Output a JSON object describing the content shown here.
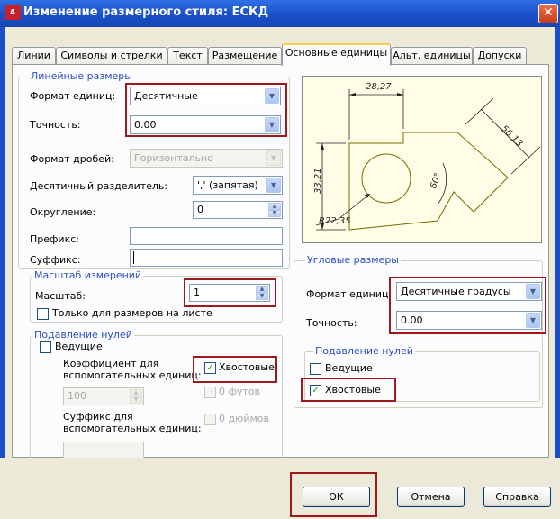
{
  "window": {
    "title": "Изменение размерного стиля: ЕСКД",
    "app_icon": "autocad-icon",
    "close_label": "✕"
  },
  "tabs": [
    {
      "label": "Линии"
    },
    {
      "label": "Символы и стрелки"
    },
    {
      "label": "Текст"
    },
    {
      "label": "Размещение"
    },
    {
      "label": "Основные единицы",
      "active": true
    },
    {
      "label": "Альт. единицы"
    },
    {
      "label": "Допуски"
    }
  ],
  "linear": {
    "legend": "Линейные размеры",
    "unit_format_label": "Формат единиц:",
    "unit_format_value": "Десятичные",
    "precision_label": "Точность:",
    "precision_value": "0.00",
    "fraction_format_label": "Формат дробей:",
    "fraction_format_value": "Горизонтально",
    "decimal_sep_label": "Десятичный разделитель:",
    "decimal_sep_value": "',' (запятая)",
    "rounding_label": "Округление:",
    "rounding_value": "0",
    "prefix_label": "Префикс:",
    "prefix_value": "",
    "suffix_label": "Суффикс:",
    "suffix_value": ""
  },
  "scale": {
    "legend": "Масштаб измерений",
    "scale_label": "Масштаб:",
    "scale_value": "1",
    "layout_only_label": "Только для размеров на листе",
    "layout_only_checked": false
  },
  "zero_linear": {
    "legend": "Подавление нулей",
    "leading_label": "Ведущие",
    "leading_checked": false,
    "sub_factor_label_1": "Коэффициент для",
    "sub_factor_label_2": "вспомогательных единиц:",
    "sub_factor_value": "100",
    "trailing_label": "Хвостовые",
    "trailing_checked": true,
    "feet_label": "0 футов",
    "sub_suffix_label_1": "Суффикс для",
    "sub_suffix_label_2": "вспомогательных единиц:",
    "sub_suffix_value": "",
    "inches_label": "0 дюймов"
  },
  "preview": {
    "dim_top": "28,27",
    "dim_left": "33,21",
    "dim_right": "56,13",
    "dim_angle": "60°",
    "dim_radius": "R22,35"
  },
  "angular": {
    "legend": "Угловые размеры",
    "unit_format_label": "Формат единиц:",
    "unit_format_value": "Десятичные градусы",
    "precision_label": "Точность:",
    "precision_value": "0.00"
  },
  "zero_angular": {
    "legend": "Подавление нулей",
    "leading_label": "Ведущие",
    "leading_checked": false,
    "trailing_label": "Хвостовые",
    "trailing_checked": true
  },
  "buttons": {
    "ok": "ОК",
    "cancel": "Отмена",
    "help": "Справка"
  },
  "colors": {
    "titlebar": "#1a4fc8",
    "group_legend": "#2a4fc9",
    "highlight_box": "#a0181e",
    "checkmark": "#21a121"
  }
}
